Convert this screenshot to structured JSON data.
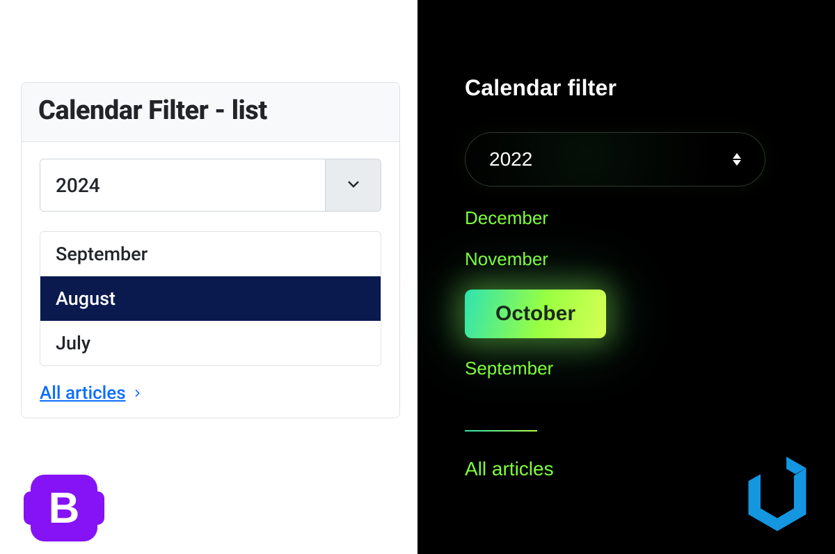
{
  "left": {
    "title": "Calendar Filter - list",
    "year_selected": "2024",
    "months": [
      {
        "label": "September",
        "active": false
      },
      {
        "label": "August",
        "active": true
      },
      {
        "label": "July",
        "active": false
      }
    ],
    "all_articles_label": "All articles",
    "logo_letter": "B",
    "accent_color": "#0d6efd",
    "active_bg": "#0a1a4f"
  },
  "right": {
    "title": "Calendar filter",
    "year_selected": "2022",
    "months": [
      {
        "label": "December",
        "active": false
      },
      {
        "label": "November",
        "active": false
      },
      {
        "label": "October",
        "active": true
      },
      {
        "label": "September",
        "active": false
      }
    ],
    "all_articles_label": "All articles",
    "accent_color": "#7eff3a"
  }
}
